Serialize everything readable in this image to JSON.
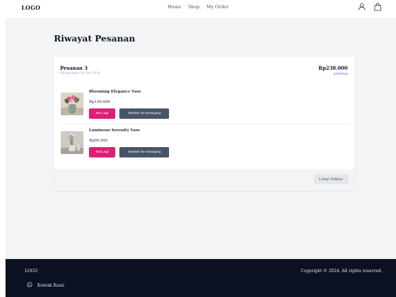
{
  "header": {
    "logo": "LOGO",
    "nav": [
      "Home",
      "Shop",
      "My Order"
    ],
    "icons": [
      "user-icon",
      "shopping-bag-icon"
    ]
  },
  "page": {
    "title": "Riwayat Pesanan"
  },
  "order": {
    "title": "Pesanan 3",
    "date": "Dibuat pada 14 Dec 2024",
    "total": "Rp238.000",
    "status": "pending",
    "items": [
      {
        "name": "Blooming Elegance Vase",
        "price": "Rp139.000",
        "buy_again": "Beli Lagi",
        "add_to_cart": "Tambah Ke Keranjang"
      },
      {
        "name": "Luminous Serenity Vase",
        "price": "Rp99.000",
        "buy_again": "Beli Lagi",
        "add_to_cart": "Tambah Ke Keranjang"
      }
    ],
    "invoice_button": "Lihat Faktur"
  },
  "footer": {
    "logo": "LOGO",
    "contact": "Kontak Kami",
    "copyright": "Copyright © 2024. All rights reserved."
  },
  "colors": {
    "accent_pink": "#e11d74",
    "slate_button": "#475569",
    "status_indigo": "#6366f1",
    "footer_bg": "#0b1120",
    "page_bg": "#f3f4f6"
  }
}
